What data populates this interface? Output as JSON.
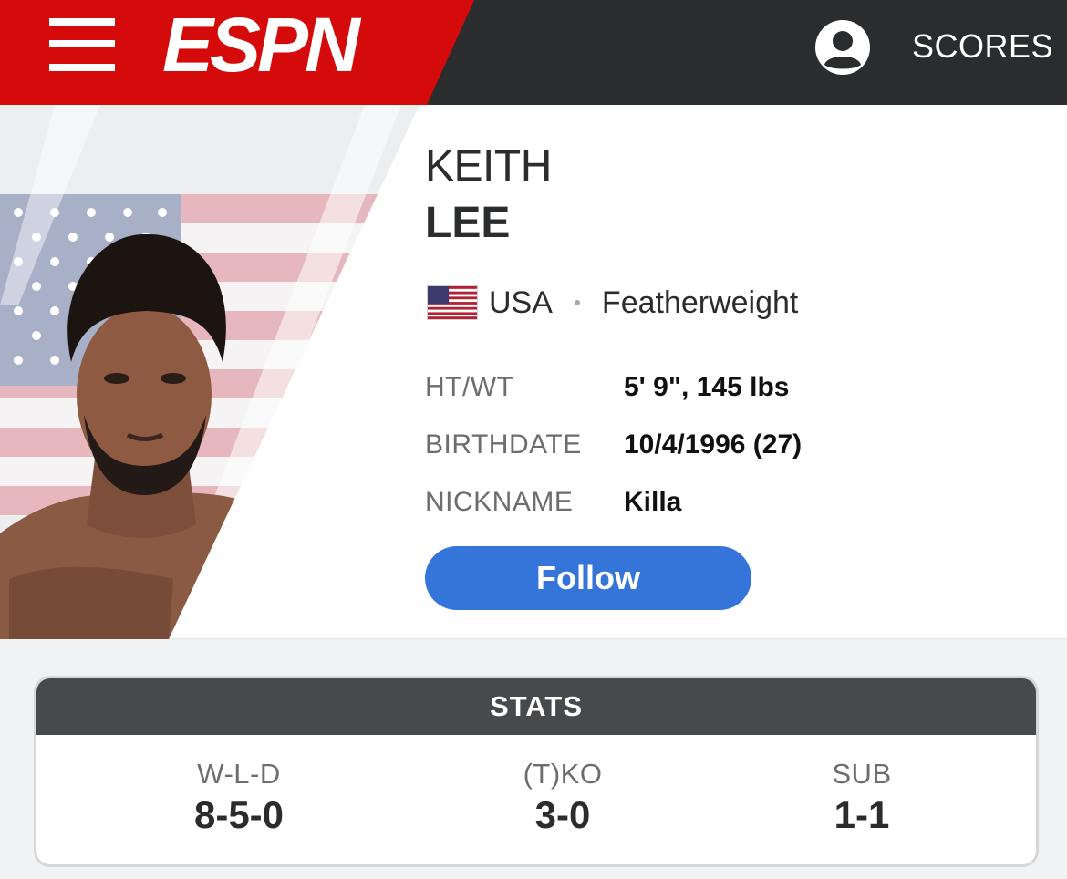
{
  "header": {
    "logo_text": "ESPN",
    "menu_icon": "hamburger-menu-icon",
    "profile_icon": "user-profile-icon",
    "scores_label": "SCORES",
    "colors": {
      "brand_red": "#d50a0a",
      "bar_dark": "#2b2c2d"
    }
  },
  "player": {
    "first_name": "KEITH",
    "last_name": "LEE",
    "country_flag_icon": "usa-flag-icon",
    "country": "USA",
    "division": "Featherweight",
    "bio": [
      {
        "label": "HT/WT",
        "value": "5' 9\", 145 lbs"
      },
      {
        "label": "BIRTHDATE",
        "value": "10/4/1996 (27)"
      },
      {
        "label": "NICKNAME",
        "value": "Killa"
      }
    ],
    "follow_label": "Follow",
    "accent_color": "#3574d9"
  },
  "stats": {
    "title": "STATS",
    "items": [
      {
        "label": "W-L-D",
        "value": "8-5-0"
      },
      {
        "label": "(T)KO",
        "value": "3-0"
      },
      {
        "label": "SUB",
        "value": "1-1"
      }
    ]
  }
}
